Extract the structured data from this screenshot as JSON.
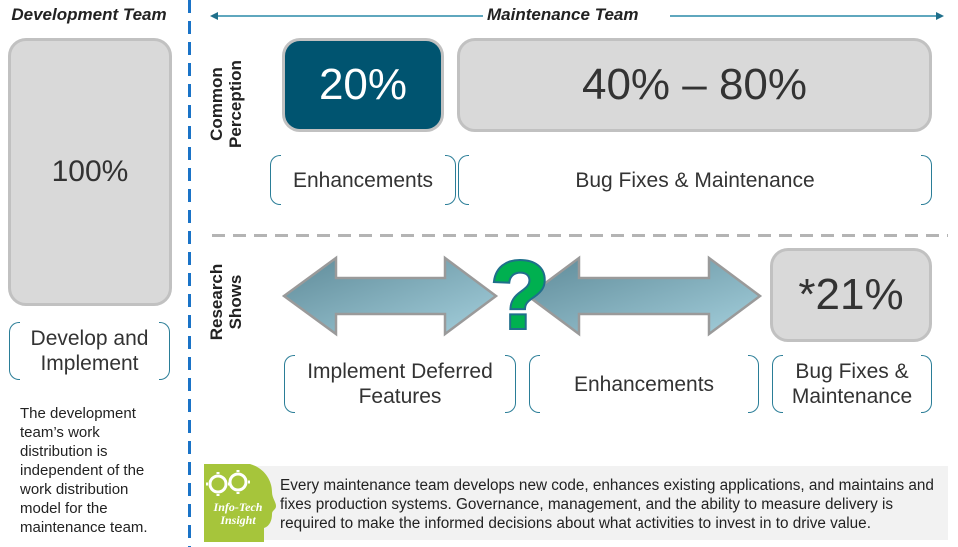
{
  "headers": {
    "development_team": "Development Team",
    "maintenance_team": "Maintenance Team"
  },
  "development": {
    "percent": "100%",
    "activity_label": "Develop and Implement",
    "note": "The development team’s work distribution is independent of the work distribution model for the maintenance team."
  },
  "rows": {
    "common_perception": {
      "label": "Common Perception",
      "enhancements_percent": "20%",
      "bugfix_percent": "40% – 80%",
      "enhancements_label": "Enhancements",
      "bugfix_label": "Bug Fixes & Maintenance"
    },
    "research_shows": {
      "label": "Research Shows",
      "bugfix_percent": "*21%",
      "deferred_label": "Implement Deferred Features",
      "enhancements_label": "Enhancements",
      "bugfix_label": "Bug Fixes & Maintenance",
      "unknown_symbol": "?"
    }
  },
  "insight": {
    "badge_line1": "Info-Tech",
    "badge_line2": "Insight",
    "text": "Every maintenance team develops new code, enhances existing applications, and maintains and fixes production systems. Governance, management, and the ability to measure delivery is required to make the informed decisions about what activities to invest in to drive value."
  },
  "colors": {
    "accent_dark_teal": "#005470",
    "bracket_teal": "#2a7d97",
    "divider_blue": "#1a73c7",
    "box_gray": "#d9d9d9",
    "question_green": "#00b050",
    "insight_green": "#a6c53b"
  }
}
